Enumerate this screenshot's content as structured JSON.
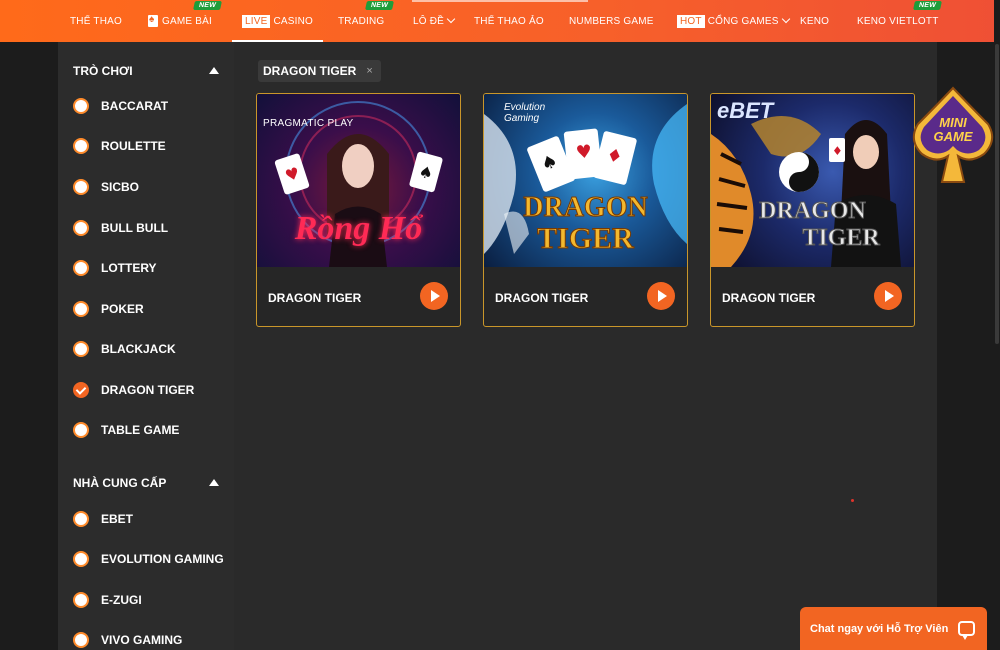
{
  "nav": {
    "items": [
      {
        "label": "THỂ THAO"
      },
      {
        "label": "GAME BÀI",
        "badge": "NEW"
      },
      {
        "pill": "LIVE",
        "label": "CASINO"
      },
      {
        "label": "TRADING",
        "badge": "NEW"
      },
      {
        "label": "LÔ ĐỀ"
      },
      {
        "label": "THỂ THAO ẢO"
      },
      {
        "label": "NUMBERS GAME"
      },
      {
        "pill": "HOT",
        "label": "CỔNG GAMES"
      },
      {
        "label": "KENO"
      },
      {
        "label": "KENO VIETLOTT",
        "badge": "NEW"
      }
    ]
  },
  "sidebar": {
    "games_title": "TRÒ CHƠI",
    "games": [
      {
        "label": "BACCARAT",
        "checked": false
      },
      {
        "label": "ROULETTE",
        "checked": false
      },
      {
        "label": "SICBO",
        "checked": false
      },
      {
        "label": "BULL BULL",
        "checked": false
      },
      {
        "label": "LOTTERY",
        "checked": false
      },
      {
        "label": "POKER",
        "checked": false
      },
      {
        "label": "BLACKJACK",
        "checked": false
      },
      {
        "label": "DRAGON TIGER",
        "checked": true
      },
      {
        "label": "TABLE GAME",
        "checked": false
      }
    ],
    "providers_title": "NHÀ CUNG CẤP",
    "providers": [
      {
        "label": "EBET"
      },
      {
        "label": "EVOLUTION GAMING"
      },
      {
        "label": "E-ZUGI"
      },
      {
        "label": "VIVO GAMING"
      }
    ]
  },
  "filter": {
    "chip": "DRAGON TIGER",
    "remove": "×"
  },
  "games": [
    {
      "name": "DRAGON TIGER",
      "provider_logo": "PRAGMATIC PLAY",
      "art_title": "Rồng Hổ"
    },
    {
      "name": "DRAGON TIGER",
      "provider_logo": "Evolution Gaming",
      "art_title_1": "DRAGON",
      "art_title_2": "TIGER"
    },
    {
      "name": "DRAGON TIGER",
      "provider_logo": "eBET",
      "art_title_1": "DRAGON",
      "art_title_2": "TIGER"
    }
  ],
  "mini_game": {
    "line1": "MINI",
    "line2": "GAME"
  },
  "chat": {
    "label": "Chat ngay với Hỗ Trợ Viên"
  },
  "colors": {
    "accent": "#f26522",
    "card_border": "#c9962a",
    "badge": "#1f9d3a"
  }
}
